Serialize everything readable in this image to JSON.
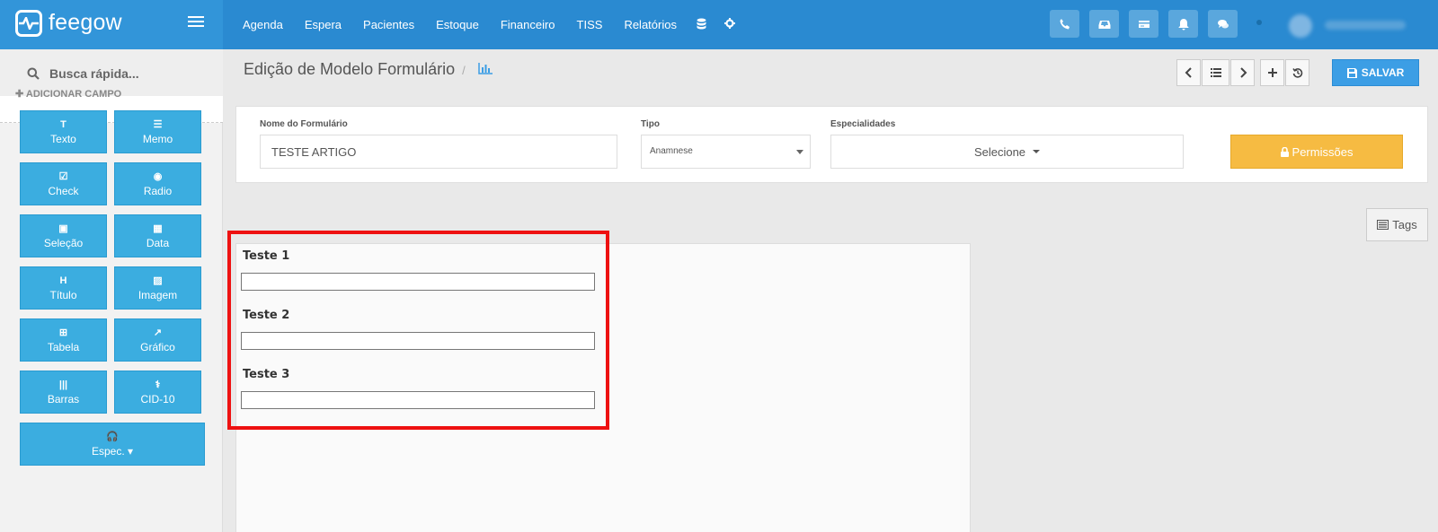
{
  "brand": {
    "name": "feegow"
  },
  "nav": {
    "items": [
      "Agenda",
      "Espera",
      "Pacientes",
      "Estoque",
      "Financeiro",
      "TISS",
      "Relatórios"
    ],
    "icons": [
      "database-icon",
      "gear-icon"
    ]
  },
  "top_actions": [
    "phone-icon",
    "inbox-icon",
    "card-icon",
    "bell-icon",
    "chat-icon"
  ],
  "sidebar": {
    "search_placeholder": "Busca rápida...",
    "add_field_title": "ADICIONAR CAMPO",
    "fields": [
      {
        "icon": "T",
        "label": "Texto"
      },
      {
        "icon": "☰",
        "label": "Memo"
      },
      {
        "icon": "☑",
        "label": "Check"
      },
      {
        "icon": "◉",
        "label": "Radio"
      },
      {
        "icon": "▣",
        "label": "Seleção"
      },
      {
        "icon": "▦",
        "label": "Data"
      },
      {
        "icon": "H",
        "label": "Título"
      },
      {
        "icon": "▨",
        "label": "Imagem"
      },
      {
        "icon": "⊞",
        "label": "Tabela"
      },
      {
        "icon": "↗",
        "label": "Gráfico"
      },
      {
        "icon": "|||",
        "label": "Barras"
      },
      {
        "icon": "⚕",
        "label": "CID-10"
      },
      {
        "icon": "🎧",
        "label": "Espec."
      }
    ]
  },
  "header": {
    "title": "Edição de Modelo Formulário",
    "separator": "/"
  },
  "toolbar": {
    "save_label": "SALVAR"
  },
  "form": {
    "name_label": "Nome do Formulário",
    "name_value": "TESTE ARTIGO",
    "type_label": "Tipo",
    "type_value": "Anamnese",
    "specialties_label": "Especialidades",
    "specialties_value": "Selecione",
    "permissions_label": "Permissões"
  },
  "tags_label": "Tags",
  "canvas_fields": [
    {
      "label": "Teste 1"
    },
    {
      "label": "Teste 2"
    },
    {
      "label": "Teste 3"
    }
  ],
  "colors": {
    "topbar": "#2a8ad1",
    "field_button": "#3bade0",
    "save_button": "#3c9ee5",
    "permissions_button": "#f6bb42",
    "highlight": "#ee1111"
  }
}
